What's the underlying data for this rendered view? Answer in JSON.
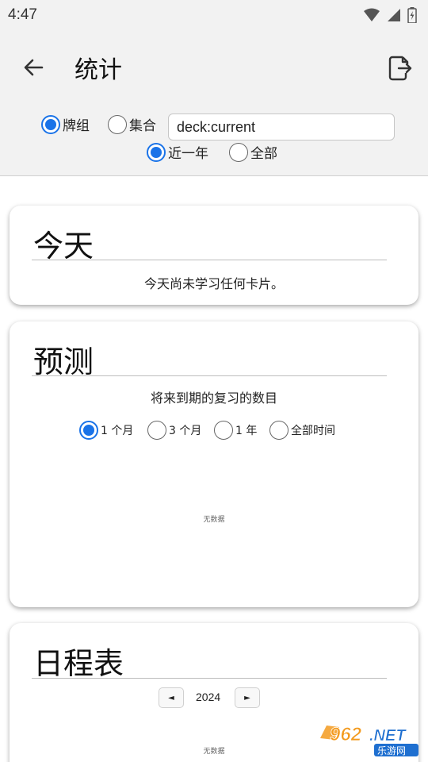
{
  "status": {
    "time": "4:47"
  },
  "header": {
    "title": "统计"
  },
  "filters": {
    "scope_options": [
      {
        "label": "牌组",
        "selected": true
      },
      {
        "label": "集合",
        "selected": false
      }
    ],
    "search_value": "deck:current",
    "range_options": [
      {
        "label": "近一年",
        "selected": true
      },
      {
        "label": "全部",
        "selected": false
      }
    ]
  },
  "today": {
    "title": "今天",
    "message": "今天尚未学习任何卡片。"
  },
  "forecast": {
    "title": "预测",
    "subtitle": "将来到期的复习的数目",
    "periods": [
      {
        "label": "1 个月",
        "selected": true
      },
      {
        "label": "3 个月",
        "selected": false
      },
      {
        "label": "1 年",
        "selected": false
      },
      {
        "label": "全部时间",
        "selected": false
      }
    ],
    "no_data": "无数据"
  },
  "calendar": {
    "title": "日程表",
    "prev_label": "◄",
    "next_label": "►",
    "year": "2024",
    "no_data": "无数据"
  },
  "watermark": {
    "number": "962",
    "suffix": ".NET",
    "caption": "乐游网"
  },
  "colors": {
    "accent": "#1a73e8",
    "watermark_orange": "#f39a1e",
    "watermark_blue": "#1e6fd0"
  }
}
